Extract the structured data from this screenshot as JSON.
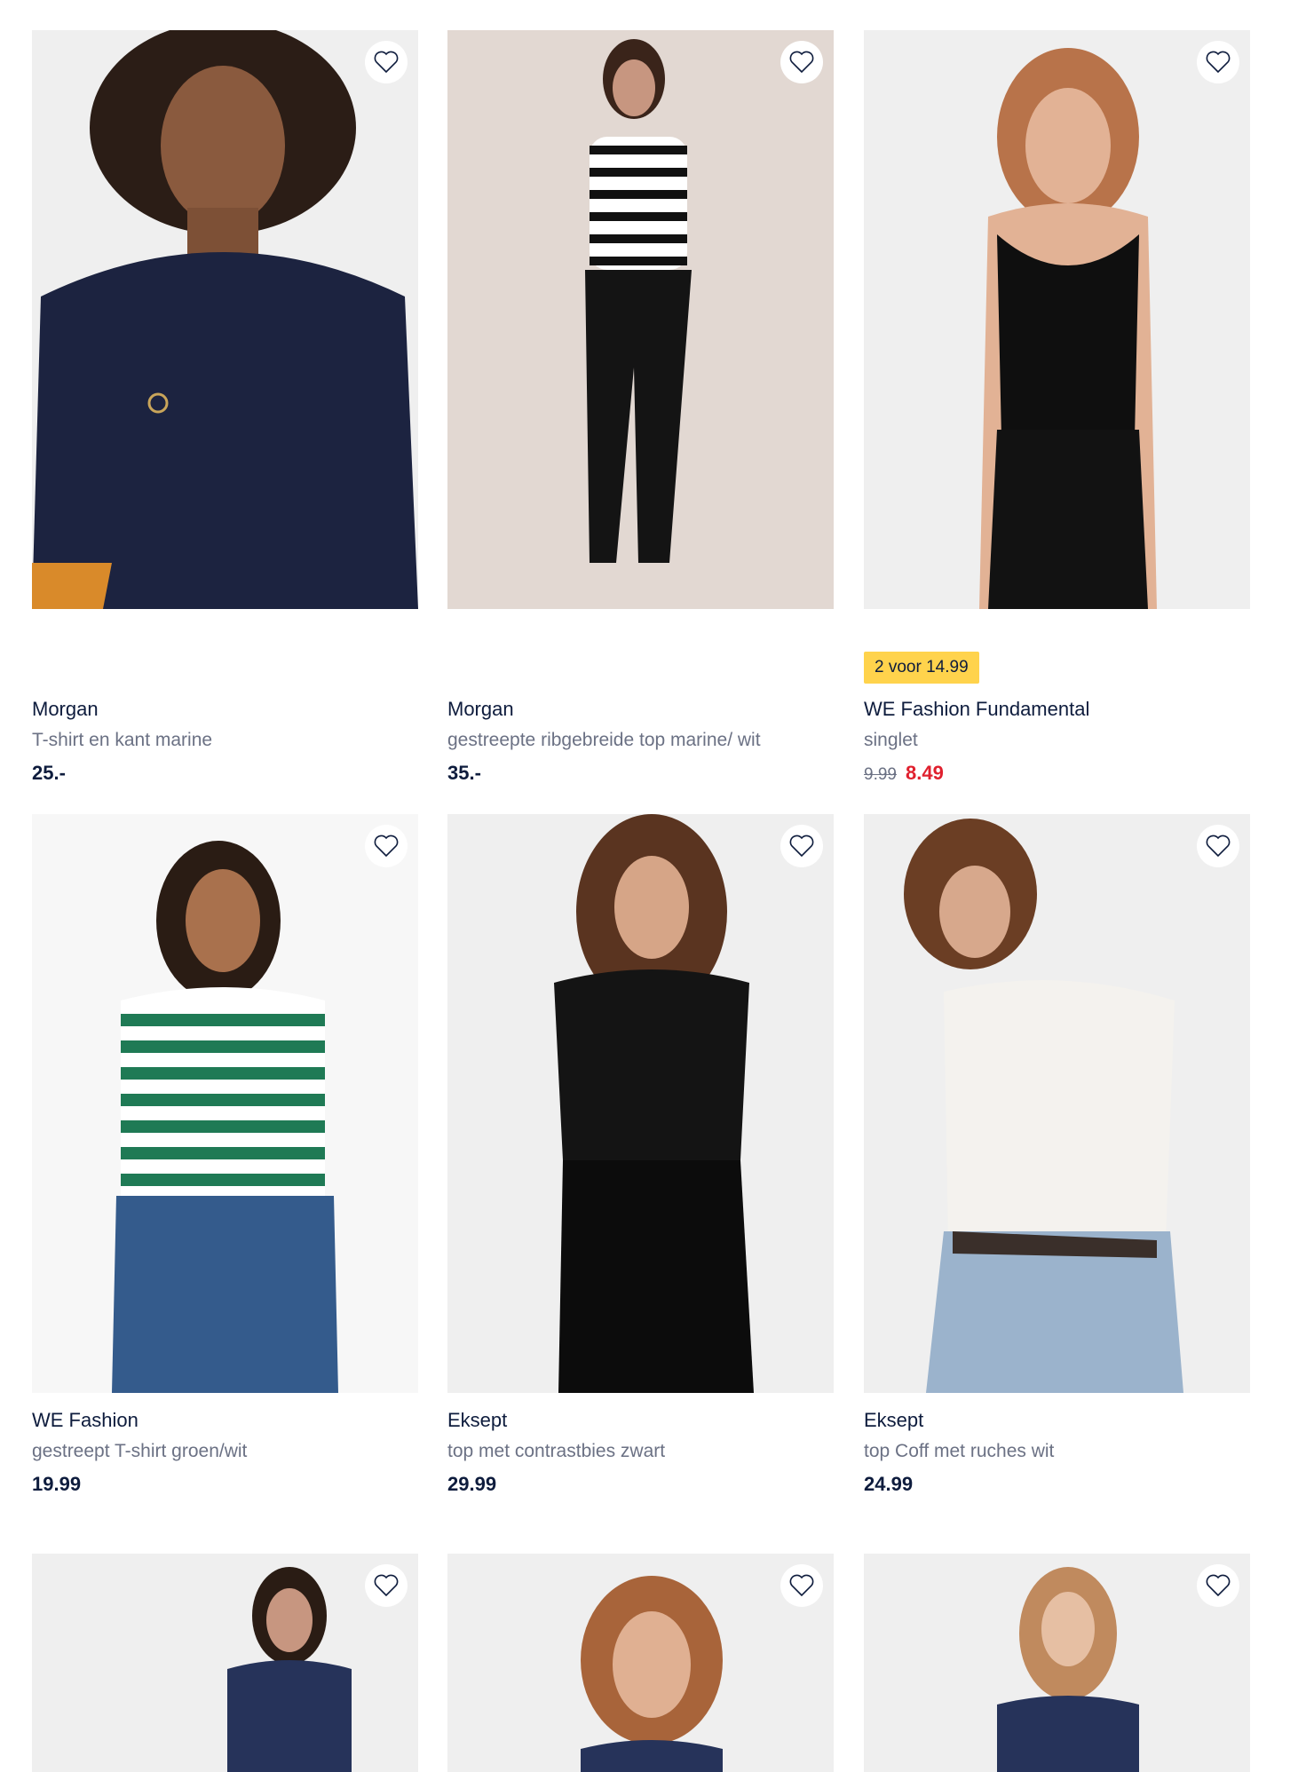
{
  "colors": {
    "text_dark": "#0e1c3d",
    "text_muted": "#6b7184",
    "sale_red": "#e0202e",
    "badge_yellow": "#ffd34c"
  },
  "icons": {
    "favorite": "heart-outline-icon"
  },
  "products": [
    {
      "brand": "Morgan",
      "description": "T-shirt en kant marine",
      "price": "25.-"
    },
    {
      "brand": "Morgan",
      "description": "gestreepte ribgebreide top marine/ wit",
      "price": "35.-"
    },
    {
      "badge": "2 voor 14.99",
      "brand": "WE Fashion Fundamental",
      "description": "singlet",
      "old_price": "9.99",
      "price": "8.49"
    },
    {
      "brand": "WE Fashion",
      "description": "gestreept T-shirt groen/wit",
      "price": "19.99"
    },
    {
      "brand": "Eksept",
      "description": "top met contrastbies zwart",
      "price": "29.99"
    },
    {
      "brand": "Eksept",
      "description": "top Coff met ruches wit",
      "price": "24.99"
    },
    {},
    {},
    {}
  ]
}
